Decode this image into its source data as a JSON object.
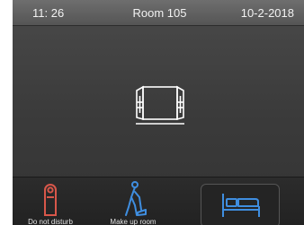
{
  "status": {
    "time": "11: 26",
    "room": "Room 105",
    "date": "10-2-2018"
  },
  "center": {
    "icon": "window-icon"
  },
  "bottom": {
    "items": [
      {
        "label": "Do not disturb",
        "icon": "door-hanger-icon",
        "color": "#d8574a"
      },
      {
        "label": "Make up room",
        "icon": "vacuum-cleaner-icon",
        "color": "#3f8ee0"
      },
      {
        "label": "",
        "icon": "bed-icon",
        "color": "#3f8ee0"
      }
    ]
  },
  "colors": {
    "panel": "#3b3b3b",
    "statusbar": "#5f5f5f",
    "dnd_accent": "#d8574a",
    "blue_accent": "#3f8ee0"
  }
}
